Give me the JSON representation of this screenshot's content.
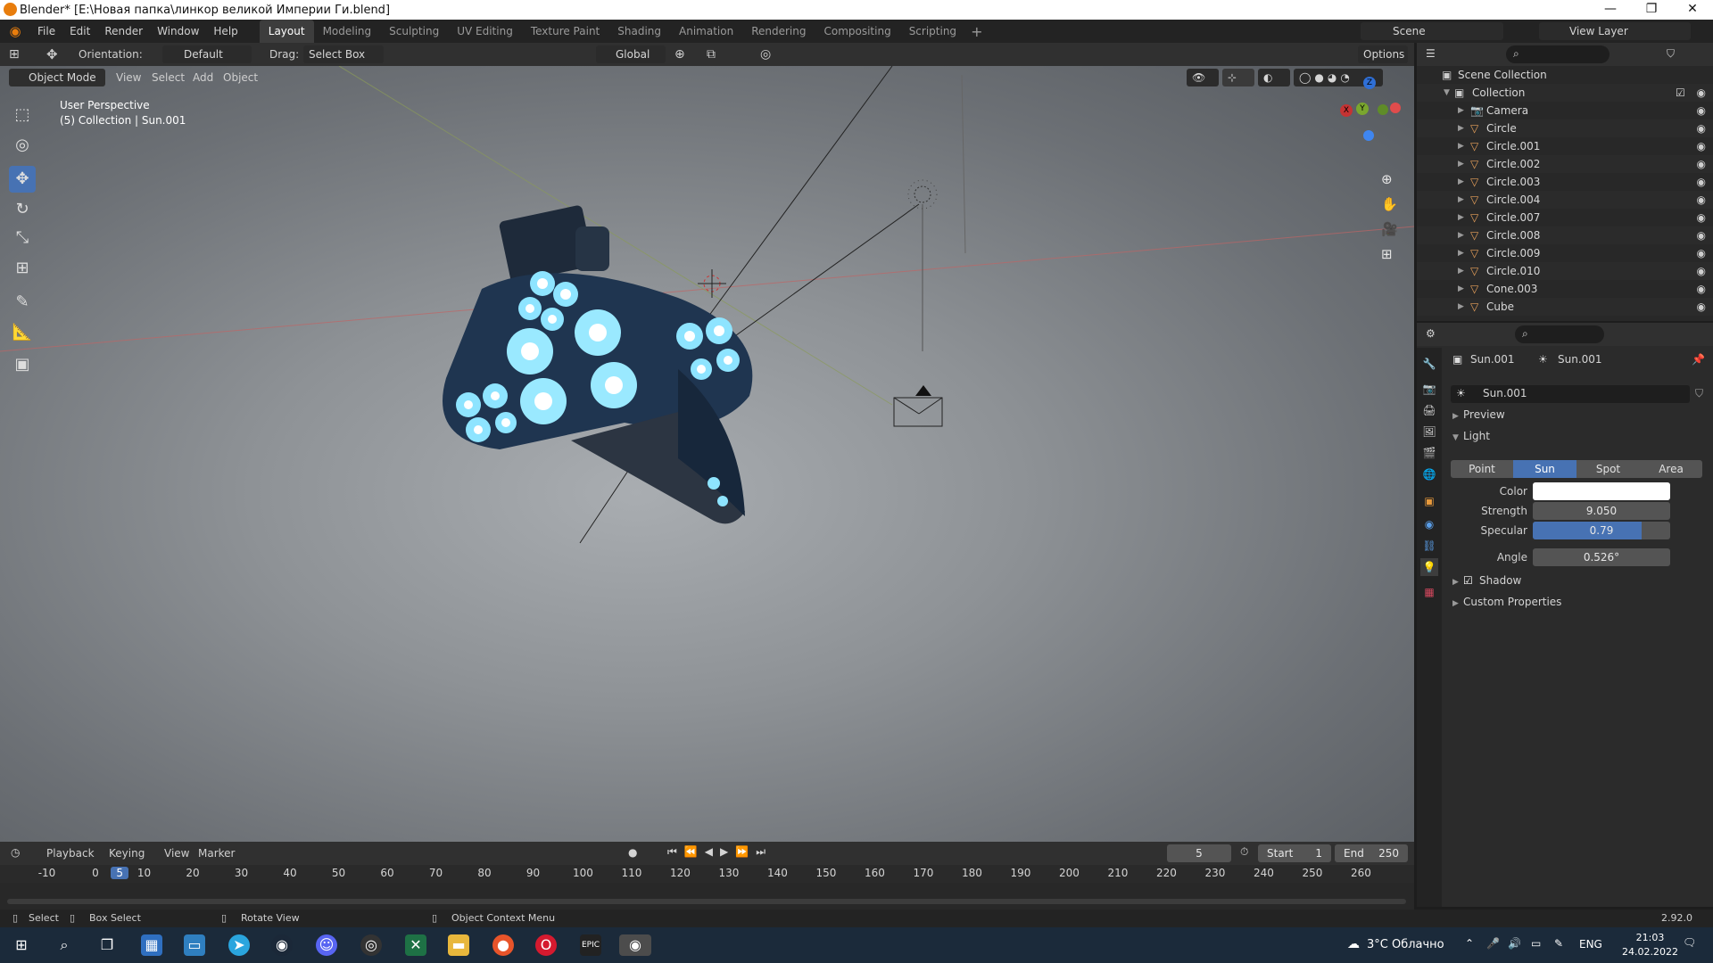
{
  "window": {
    "title": "Blender* [E:\\Новая папка\\линкор великой Империи Ги.blend]",
    "controls": [
      "—",
      "❐",
      "✕"
    ]
  },
  "menu": [
    "File",
    "Edit",
    "Render",
    "Window",
    "Help"
  ],
  "workspaces": [
    "Layout",
    "Modeling",
    "Sculpting",
    "UV Editing",
    "Texture Paint",
    "Shading",
    "Animation",
    "Rendering",
    "Compositing",
    "Scripting"
  ],
  "scene": {
    "label": "Scene",
    "view_layer": "View Layer"
  },
  "viewport_header": {
    "orientation_label": "Orientation:",
    "orientation_value": "Default",
    "drag_label": "Drag:",
    "drag_value": "Select Box",
    "transform_space": "Global",
    "options": "Options",
    "mode": "Object Mode",
    "menus": [
      "View",
      "Select",
      "Add",
      "Object"
    ]
  },
  "viewport_info": {
    "perspective": "User Perspective",
    "collection": "(5) Collection | Sun.001"
  },
  "gizmo": {
    "x": "X",
    "y": "Y",
    "z": "Z"
  },
  "outliner": {
    "root": "Scene Collection",
    "collection": "Collection",
    "items": [
      "Camera",
      "Circle",
      "Circle.001",
      "Circle.002",
      "Circle.003",
      "Circle.004",
      "Circle.007",
      "Circle.008",
      "Circle.009",
      "Circle.010",
      "Cone.003",
      "Cube"
    ]
  },
  "properties": {
    "object_name": "Sun.001",
    "data_name": "Sun.001",
    "datablock": "Sun.001",
    "sections": {
      "preview": "Preview",
      "light": "Light",
      "shadow": "Shadow",
      "custom": "Custom Properties"
    },
    "light_types": [
      "Point",
      "Sun",
      "Spot",
      "Area"
    ],
    "active_type": "Sun",
    "fields": {
      "color_label": "Color",
      "strength_label": "Strength",
      "strength_value": "9.050",
      "specular_label": "Specular",
      "specular_value": "0.79",
      "specular_fraction": 0.79,
      "angle_label": "Angle",
      "angle_value": "0.526°"
    }
  },
  "timeline": {
    "menus": [
      "Playback",
      "Keying",
      "View",
      "Marker"
    ],
    "current_frame": "5",
    "start_label": "Start",
    "start_value": "1",
    "end_label": "End",
    "end_value": "250",
    "ticks": [
      "-10",
      "0",
      "5",
      "10",
      "20",
      "30",
      "40",
      "50",
      "60",
      "70",
      "80",
      "90",
      "100",
      "110",
      "120",
      "130",
      "140",
      "150",
      "160",
      "170",
      "180",
      "190",
      "200",
      "210",
      "220",
      "230",
      "240",
      "250",
      "260"
    ]
  },
  "status_bar": {
    "select": "Select",
    "box_select": "Box Select",
    "rotate": "Rotate View",
    "context_menu": "Object Context Menu",
    "version": "2.92.0"
  },
  "taskbar": {
    "weather": "3°C Облачно",
    "lang": "ENG",
    "time": "21:03",
    "date": "24.02.2022"
  }
}
